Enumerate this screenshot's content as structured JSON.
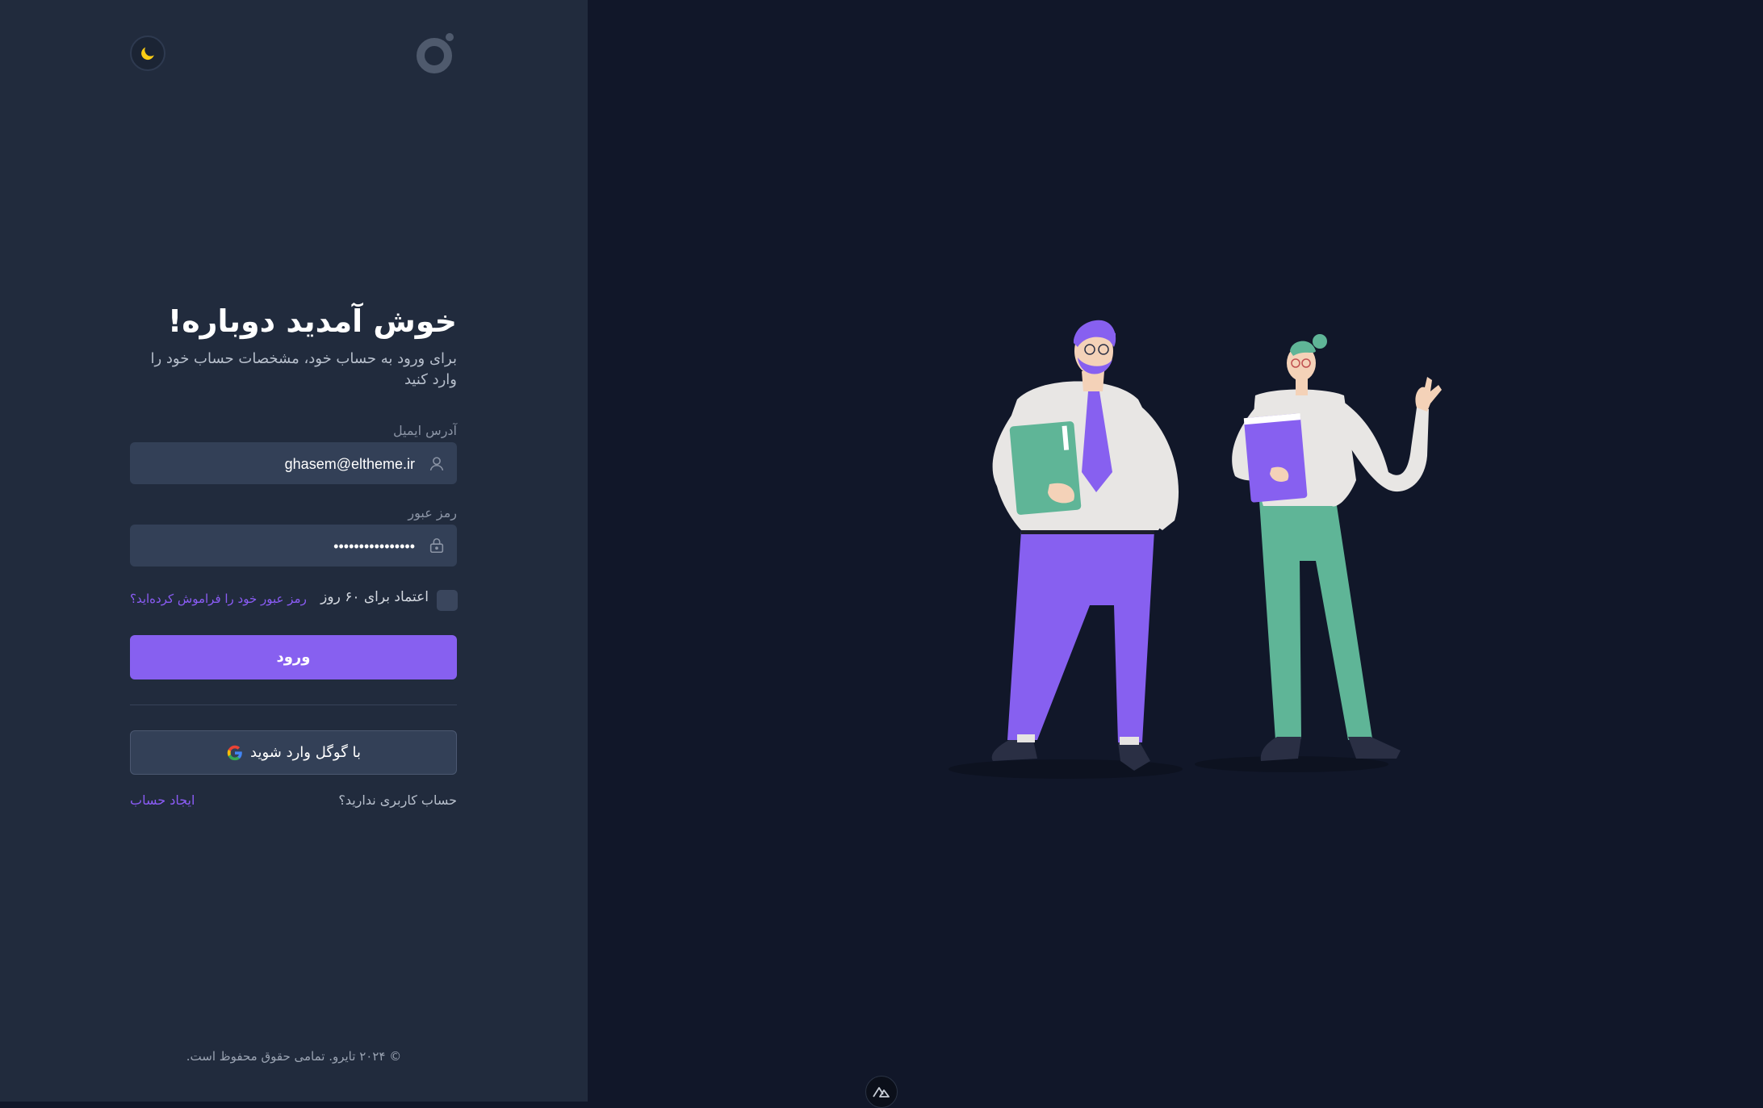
{
  "login": {
    "heading": "خوش آمدید دوباره!",
    "subtitle": "برای ورود به حساب خود، مشخصات حساب خود را وارد کنید",
    "email_label": "آدرس ایمیل",
    "email_value": "ghasem@eltheme.ir",
    "password_label": "رمز عبور",
    "password_value": "••••••••••••••••",
    "remember_label": "اعتماد برای ۶۰ روز",
    "forgot_link": "رمز عبور خود را فراموش کرده‌اید؟",
    "login_button": "ورود",
    "google_button": "با گوگل وارد شوید",
    "no_account_text": "حساب کاربری ندارید؟",
    "create_account_link": "ایجاد حساب",
    "copyright": "© ۲۰۲۴ تایرو. تمامی حقوق محفوظ است."
  },
  "icons": {
    "theme_toggle": "moon-icon",
    "logo": "logo-icon",
    "email_field": "user-icon",
    "password_field": "lock-icon",
    "google": "google-icon",
    "devtools": "nuxt-icon"
  },
  "colors": {
    "accent": "#8760f0",
    "left_panel_bg": "#212b3d",
    "right_panel_bg": "#111729",
    "field_bg": "#334057",
    "moon": "#facc15"
  }
}
